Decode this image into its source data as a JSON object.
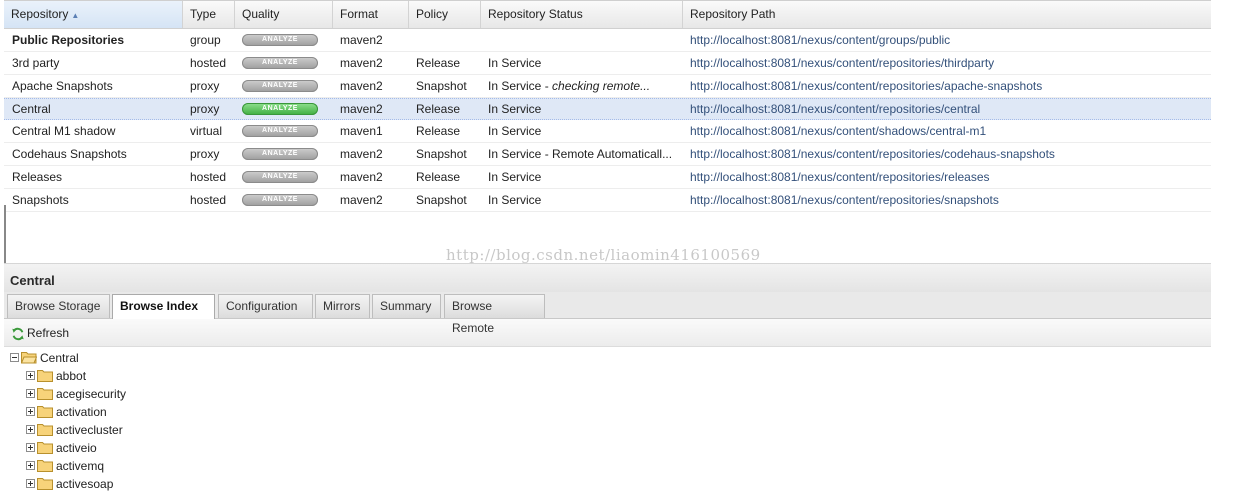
{
  "columns": {
    "repository": "Repository",
    "type": "Type",
    "quality": "Quality",
    "format": "Format",
    "policy": "Policy",
    "status": "Repository Status",
    "path": "Repository Path"
  },
  "rows": [
    {
      "name": "Public Repositories",
      "type": "group",
      "quality": "ANALYZE",
      "format": "maven2",
      "policy": "",
      "status": "",
      "path": "http://localhost:8081/nexus/content/groups/public"
    },
    {
      "name": "3rd party",
      "type": "hosted",
      "quality": "ANALYZE",
      "format": "maven2",
      "policy": "Release",
      "status": "In Service",
      "path": "http://localhost:8081/nexus/content/repositories/thirdparty"
    },
    {
      "name": "Apache Snapshots",
      "type": "proxy",
      "quality": "ANALYZE",
      "format": "maven2",
      "policy": "Snapshot",
      "status_prefix": "In Service - ",
      "status_italic": "checking remote...",
      "path": "http://localhost:8081/nexus/content/repositories/apache-snapshots"
    },
    {
      "name": "Central",
      "type": "proxy",
      "quality": "ANALYZE",
      "format": "maven2",
      "policy": "Release",
      "status": "In Service",
      "path": "http://localhost:8081/nexus/content/repositories/central"
    },
    {
      "name": "Central M1 shadow",
      "type": "virtual",
      "quality": "ANALYZE",
      "format": "maven1",
      "policy": "Release",
      "status": "In Service",
      "path": "http://localhost:8081/nexus/content/shadows/central-m1"
    },
    {
      "name": "Codehaus Snapshots",
      "type": "proxy",
      "quality": "ANALYZE",
      "format": "maven2",
      "policy": "Snapshot",
      "status": "In Service - Remote Automaticall...",
      "path": "http://localhost:8081/nexus/content/repositories/codehaus-snapshots"
    },
    {
      "name": "Releases",
      "type": "hosted",
      "quality": "ANALYZE",
      "format": "maven2",
      "policy": "Release",
      "status": "In Service",
      "path": "http://localhost:8081/nexus/content/repositories/releases"
    },
    {
      "name": "Snapshots",
      "type": "hosted",
      "quality": "ANALYZE",
      "format": "maven2",
      "policy": "Snapshot",
      "status": "In Service",
      "path": "http://localhost:8081/nexus/content/repositories/snapshots"
    }
  ],
  "watermark": "http://blog.csdn.net/liaomin416100569",
  "panel": {
    "title": "Central",
    "tabs": [
      "Browse Storage",
      "Browse Index",
      "Configuration",
      "Mirrors",
      "Summary",
      "Browse Remote"
    ],
    "active_tab": "Browse Index",
    "refresh_label": "Refresh",
    "tree_root": "Central",
    "tree_children": [
      "abbot",
      "acegisecurity",
      "activation",
      "activecluster",
      "activeio",
      "activemq",
      "activesoap"
    ]
  },
  "colors": {
    "selected_row": "#dfe8f6",
    "analyze_active": "#3fae3f",
    "analyze_inactive": "#9d9d9d",
    "path_link": "#33507a"
  },
  "icons": {
    "sort": "sort-ascending-icon",
    "refresh": "refresh-icon",
    "folder": "folder-icon"
  }
}
